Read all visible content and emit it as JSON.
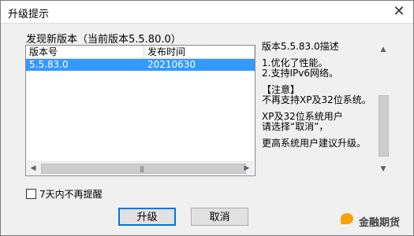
{
  "window": {
    "title": "升级提示",
    "close_glyph": "✕"
  },
  "found_version_text": "发现新版本（当前版本5.5.80.0）",
  "version_list": {
    "columns": [
      "版本号",
      "发布时间"
    ],
    "rows": [
      {
        "version": "5.5.83.0",
        "date": "20210630",
        "selected": true
      }
    ],
    "grip": "|||"
  },
  "description": {
    "lines": [
      "版本5.5.83.0描述",
      "",
      "1.优化了性能。",
      "2.支持IPv6网络。",
      "",
      "【注意】",
      "不再支持XP及32位系统。",
      "",
      "XP及32位系统用户",
      "请选择“取消”，",
      "",
      "更高系统用户建议升级。"
    ]
  },
  "checkbox": {
    "label": "7天内不再提醒",
    "checked": false
  },
  "buttons": {
    "upgrade": "升级",
    "cancel": "取消"
  },
  "watermark": {
    "text": "金融期货"
  },
  "colors": {
    "selection": "#3399ff",
    "accent": "#0078d7"
  }
}
